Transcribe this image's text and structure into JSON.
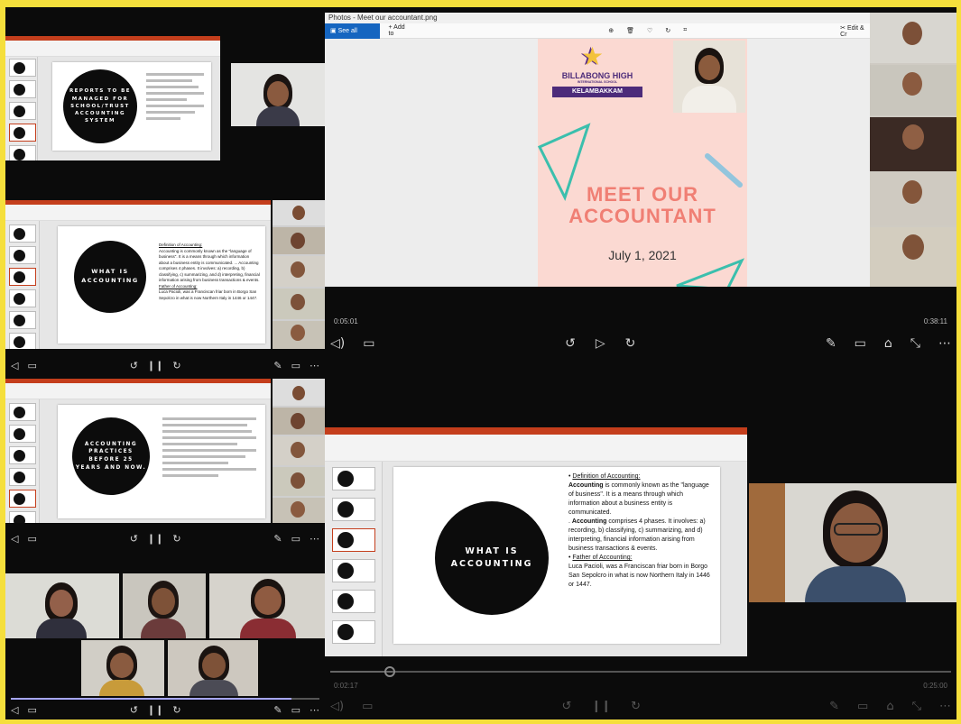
{
  "photos": {
    "window_title": "Photos - Meet our accountant.png",
    "see_all": "See all photos",
    "add_to": "+ Add to",
    "edit": "Edit & Cr",
    "poster": {
      "school_line1": "BILLABONG HIGH",
      "school_line2": "INTERNATIONAL SCHOOL",
      "campus": "KELAMBAKKAM",
      "headline1": "MEET OUR",
      "headline2": "ACCOUNTANT",
      "date": "July 1, 2021"
    },
    "time_elapsed": "0:05:01",
    "time_total": "0:38:11"
  },
  "slides": {
    "slide1_title": "REPORTS TO BE\nMANAGED FOR\nSCHOOL/TRUST\nACCOUNTING\nSYSTEM",
    "slide2_title": "WHAT IS\nACCOUNTING",
    "slide3_title": "ACCOUNTING\nPRACTICES\nBEFORE 25\nYEARS AND NOW.",
    "main_title": "WHAT IS\nACCOUNTING"
  },
  "definition": {
    "heading": "Definition of Accounting:",
    "para1_bold": "Accounting",
    "para1": " is commonly known as the \"language of business\". It is a means through which information about a business entity is communicated.",
    "para2_prefix": ". ",
    "para2_bold": "Accounting",
    "para2": " comprises 4 phases. It involves: a) recording, b) classifying, c) summarizing, and d) interpreting, financial information arising from business transactions & events.",
    "heading2": "Father of Accounting:",
    "para3": "Luca Pacioli, was a Franciscan friar born in Borgo San Sepolcro in what is now Northern Italy in 1446 or 1447."
  },
  "small_def": {
    "heading": "Definition of Accounting:",
    "text": "Accounting is commonly known as the \"language of business\". It is a means through which information about a business entity is communicated. ... Accounting comprises 4 phases. It involves: a) recording, b) classifying, c) summarizing, and d) interpreting, financial information arising from business transactions & events.",
    "heading2": "Father of Accounting:",
    "text2": "Luca Pacioli, was a Franciscan friar born in Borgo San Sepolcro in what is now Northern Italy in 1446 or 1447."
  },
  "br_player": {
    "time_elapsed": "0:02:17",
    "time_total": "0:25:00"
  },
  "colors": {
    "frame": "#f5df3c",
    "ppt_accent": "#c43e1c",
    "seek": "#a7a7ff",
    "player_bg": "#0b0b0b"
  }
}
